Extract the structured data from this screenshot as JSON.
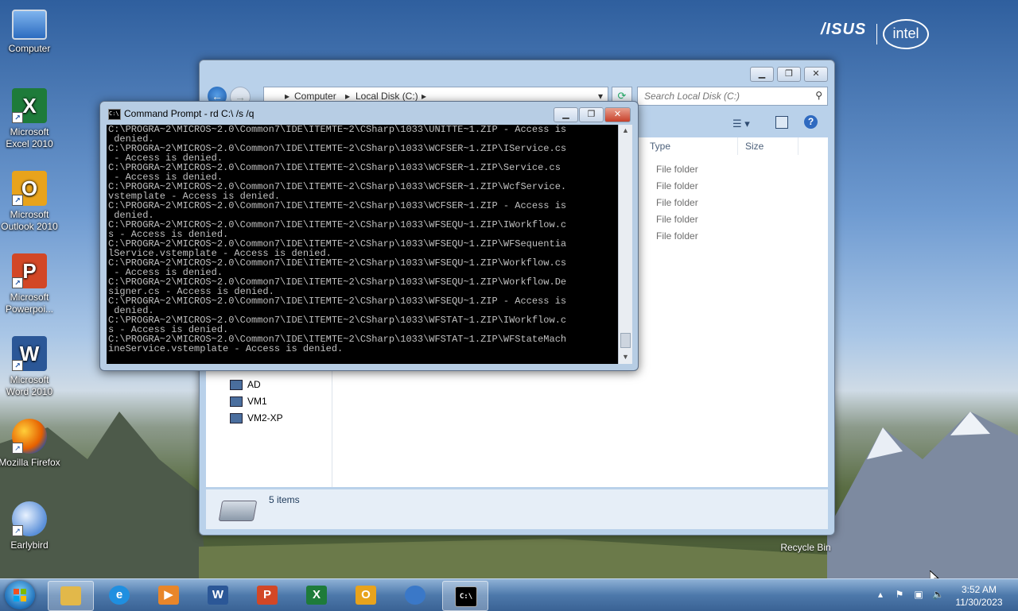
{
  "desktop": {
    "icons": [
      {
        "label": "Computer",
        "icon": "computer-icon",
        "color": "#3a7bd5"
      },
      {
        "label": "Microsoft Excel 2010",
        "icon": "excel-icon",
        "color": "#1e7b3a"
      },
      {
        "label": "Microsoft Outlook 2010",
        "icon": "outlook-icon",
        "color": "#e8a31c"
      },
      {
        "label": "Microsoft Powerpoi...",
        "icon": "powerpoint-icon",
        "color": "#d24726"
      },
      {
        "label": "Microsoft Word 2010",
        "icon": "word-icon",
        "color": "#2b5797"
      },
      {
        "label": "Mozilla Firefox",
        "icon": "firefox-icon",
        "color": "#e66000"
      },
      {
        "label": "Earlybird",
        "icon": "earlybird-icon",
        "color": "#5a8fd8"
      }
    ],
    "recycle_bin_label": "Recycle Bin",
    "brand_left": "/ISUS",
    "brand_right": "intel"
  },
  "explorer": {
    "breadcrumb": [
      "Computer",
      "Local Disk (C:)"
    ],
    "search_placeholder": "Search Local Disk (C:)",
    "columns": [
      "Type",
      "Size"
    ],
    "rows": [
      {
        "type": "File folder"
      },
      {
        "type": "File folder"
      },
      {
        "type": "File folder"
      },
      {
        "type": "File folder"
      },
      {
        "type": "File folder"
      }
    ],
    "nav_items": [
      "AD",
      "VM1",
      "VM2-XP"
    ],
    "status_text": "5 items"
  },
  "cmd": {
    "title": "Command Prompt - rd  C:\\ /s /q",
    "icon_text": "C:\\",
    "lines": [
      "C:\\PROGRA~2\\MICROS~2.0\\Common7\\IDE\\ITEMTE~2\\CSharp\\1033\\UNITTE~1.ZIP - Access is",
      " denied.",
      "C:\\PROGRA~2\\MICROS~2.0\\Common7\\IDE\\ITEMTE~2\\CSharp\\1033\\WCFSER~1.ZIP\\IService.cs",
      " - Access is denied.",
      "C:\\PROGRA~2\\MICROS~2.0\\Common7\\IDE\\ITEMTE~2\\CSharp\\1033\\WCFSER~1.ZIP\\Service.cs",
      " - Access is denied.",
      "C:\\PROGRA~2\\MICROS~2.0\\Common7\\IDE\\ITEMTE~2\\CSharp\\1033\\WCFSER~1.ZIP\\WcfService.",
      "vstemplate - Access is denied.",
      "C:\\PROGRA~2\\MICROS~2.0\\Common7\\IDE\\ITEMTE~2\\CSharp\\1033\\WCFSER~1.ZIP - Access is",
      " denied.",
      "C:\\PROGRA~2\\MICROS~2.0\\Common7\\IDE\\ITEMTE~2\\CSharp\\1033\\WFSEQU~1.ZIP\\IWorkflow.c",
      "s - Access is denied.",
      "C:\\PROGRA~2\\MICROS~2.0\\Common7\\IDE\\ITEMTE~2\\CSharp\\1033\\WFSEQU~1.ZIP\\WFSequentia",
      "lService.vstemplate - Access is denied.",
      "C:\\PROGRA~2\\MICROS~2.0\\Common7\\IDE\\ITEMTE~2\\CSharp\\1033\\WFSEQU~1.ZIP\\Workflow.cs",
      " - Access is denied.",
      "C:\\PROGRA~2\\MICROS~2.0\\Common7\\IDE\\ITEMTE~2\\CSharp\\1033\\WFSEQU~1.ZIP\\Workflow.De",
      "signer.cs - Access is denied.",
      "C:\\PROGRA~2\\MICROS~2.0\\Common7\\IDE\\ITEMTE~2\\CSharp\\1033\\WFSEQU~1.ZIP - Access is",
      " denied.",
      "C:\\PROGRA~2\\MICROS~2.0\\Common7\\IDE\\ITEMTE~2\\CSharp\\1033\\WFSTAT~1.ZIP\\IWorkflow.c",
      "s - Access is denied.",
      "C:\\PROGRA~2\\MICROS~2.0\\Common7\\IDE\\ITEMTE~2\\CSharp\\1033\\WFSTAT~1.ZIP\\WFStateMach",
      "ineService.vstemplate - Access is denied."
    ]
  },
  "taskbar": {
    "items": [
      {
        "name": "explorer-taskbar-button",
        "icon": "folder-icon",
        "glyph": "",
        "color": "#e2b84a",
        "active": true
      },
      {
        "name": "ie-taskbar-button",
        "icon": "internet-explorer-icon",
        "glyph": "e",
        "color": "#1f8fe0",
        "active": false
      },
      {
        "name": "media-player-taskbar-button",
        "icon": "media-player-icon",
        "glyph": "▶",
        "color": "#e8862a",
        "active": false
      },
      {
        "name": "word-taskbar-button",
        "icon": "word-icon",
        "glyph": "W",
        "color": "#2b5797",
        "active": false
      },
      {
        "name": "powerpoint-taskbar-button",
        "icon": "powerpoint-icon",
        "glyph": "P",
        "color": "#d24726",
        "active": false
      },
      {
        "name": "excel-taskbar-button",
        "icon": "excel-icon",
        "glyph": "X",
        "color": "#1e7b3a",
        "active": false
      },
      {
        "name": "outlook-taskbar-button",
        "icon": "outlook-icon",
        "glyph": "O",
        "color": "#e8a31c",
        "active": false
      },
      {
        "name": "chrome-taskbar-button",
        "icon": "chrome-icon",
        "glyph": "",
        "color": "#3a78c8",
        "active": false
      },
      {
        "name": "cmd-taskbar-button",
        "icon": "command-prompt-icon",
        "glyph": "C:\\",
        "color": "#000000",
        "active": true
      }
    ],
    "time": "3:52 AM",
    "date": "11/30/2023"
  }
}
